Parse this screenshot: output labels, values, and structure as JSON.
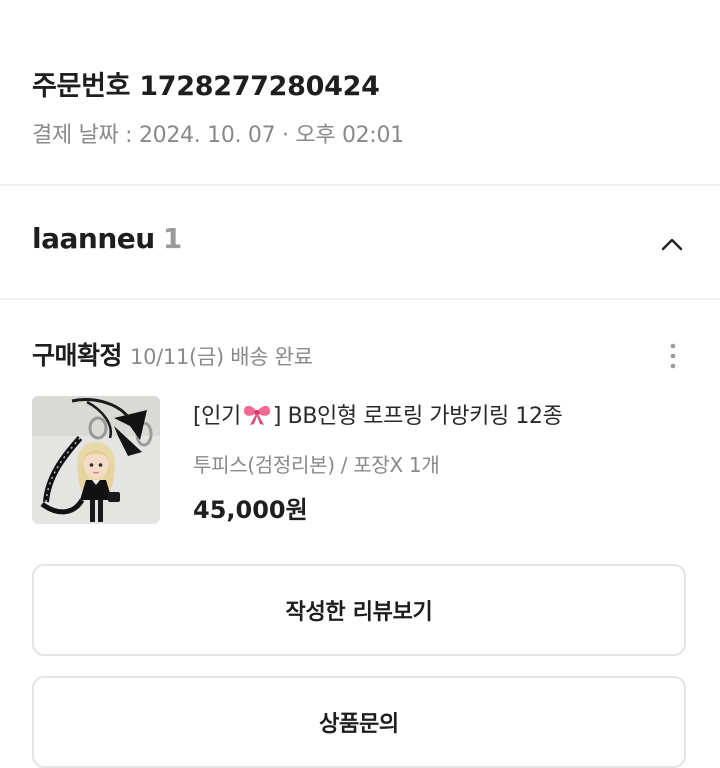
{
  "order": {
    "number_label": "주문번호 1728277280424",
    "payment_date": "결제 날짜 : 2024. 10. 07 · 오후 02:01"
  },
  "seller": {
    "name": "laanneu",
    "count": "1",
    "toggle_icon": "chevron-up-icon"
  },
  "status": {
    "title": "구매확정",
    "subtitle": "10/11(금) 배송 완료",
    "menu_icon": "more-vertical-icon"
  },
  "product": {
    "title_prefix": "[인기",
    "title_suffix": "] BB인형 로프링 가방키링 12종",
    "title_emoji_icon": "ribbon-bow-icon",
    "option": "투피스(검정리본) / 포장X 1개",
    "price": "45,000원",
    "image_icon": "doll-keyring-photo"
  },
  "actions": {
    "review_label": "작성한 리뷰보기",
    "inquiry_label": "상품문의"
  },
  "colors": {
    "text_primary": "#1e1e1e",
    "text_secondary": "#8a8a8a",
    "border": "#e4e4e4",
    "ribbon": "#e8457a"
  }
}
